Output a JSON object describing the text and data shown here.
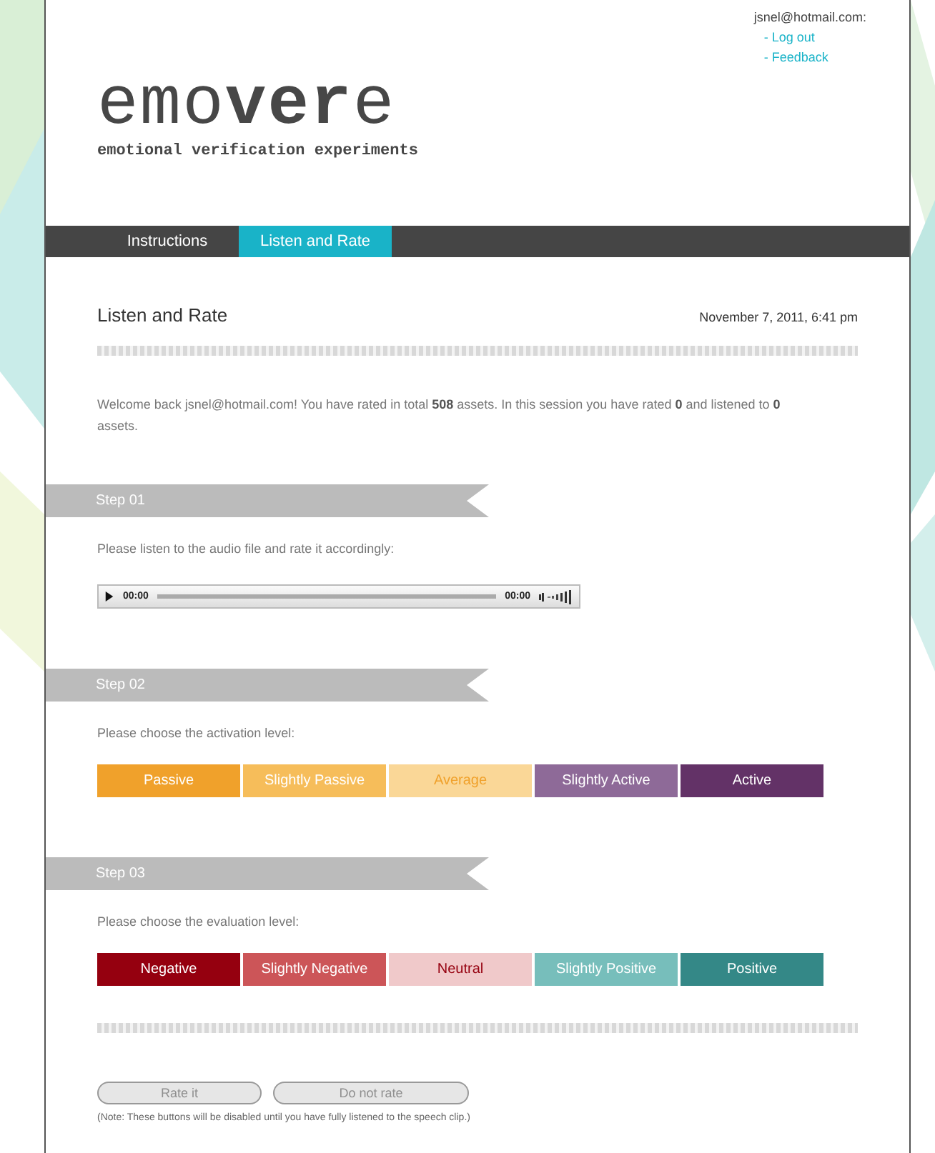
{
  "account": {
    "email": "jsnel@hotmail.com:",
    "links": [
      "- Log out",
      "- Feedback"
    ]
  },
  "logo": {
    "wordmark": "emo**ver**e",
    "tagline": "emotional verification experiments"
  },
  "tabs": [
    {
      "label": "Instructions",
      "selected": false
    },
    {
      "label": "Listen and Rate",
      "selected": true
    }
  ],
  "page": {
    "title": "Listen and Rate",
    "date": "November 7, 2011, 6:41 pm",
    "welcome": "Welcome back jsnel@hotmail.com! You have rated in total **508** assets. In this session you have rated **0** and listened to **0** assets."
  },
  "steps": [
    {
      "label": "Step 01",
      "prompt": "Please listen to the audio file and rate it accordingly:",
      "kind": "audio",
      "player": {
        "elapsed": "00:00",
        "duration": "00:00"
      }
    },
    {
      "label": "Step 02",
      "prompt": "Please choose the activation level:",
      "kind": "scale",
      "options": [
        {
          "label": "Passive",
          "color": "#f0a12b",
          "kind": "strong"
        },
        {
          "label": "Slightly Passive",
          "color": "#f6bd5a",
          "kind": "strong"
        },
        {
          "label": "Average",
          "color": "#fad797",
          "kind": "pale"
        },
        {
          "label": "Slightly Active",
          "color": "#8e6a98",
          "kind": "strong"
        },
        {
          "label": "Active",
          "color": "#633267",
          "kind": "strong"
        }
      ]
    },
    {
      "label": "Step 03",
      "prompt": "Please choose the evaluation level:",
      "kind": "scale",
      "options": [
        {
          "label": "Negative",
          "color": "#95000f",
          "kind": "strong"
        },
        {
          "label": "Slightly Negative",
          "color": "#cc5558",
          "kind": "strong"
        },
        {
          "label": "Neutral",
          "color": "#f0c9ca",
          "kind": "pale"
        },
        {
          "label": "Slightly Positive",
          "color": "#77bebb",
          "kind": "strong"
        },
        {
          "label": "Positive",
          "color": "#348887",
          "kind": "strong"
        }
      ]
    }
  ],
  "actions": [
    {
      "label": "Rate it",
      "disabled": true
    },
    {
      "label": "Do not rate",
      "disabled": true
    }
  ],
  "note": "(Note: These buttons will be disabled until you have fully listened to the speech clip.)"
}
